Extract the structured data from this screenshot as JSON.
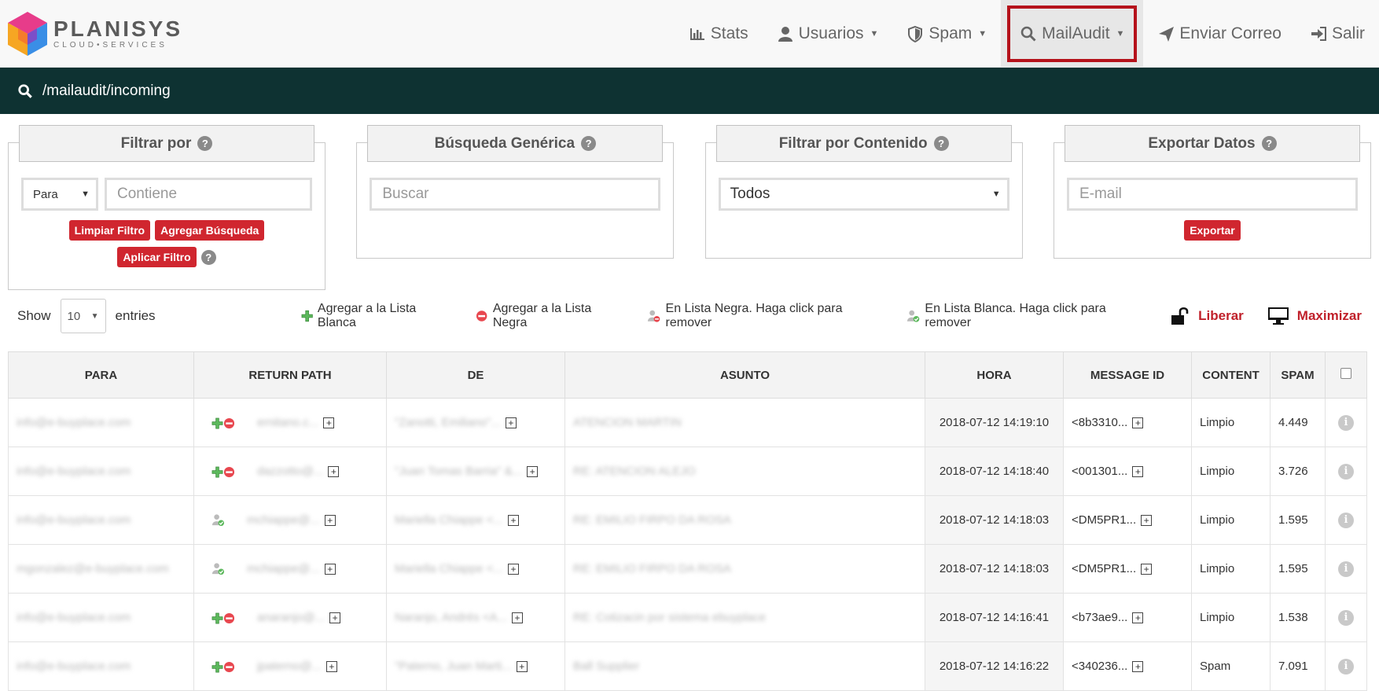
{
  "brand": {
    "name": "PLANISYS",
    "sub": "CLOUD•SERVICES"
  },
  "nav": {
    "stats": "Stats",
    "usuarios": "Usuarios",
    "spam": "Spam",
    "mailaudit": "MailAudit",
    "enviar": "Enviar Correo",
    "salir": "Salir"
  },
  "path": "/mailaudit/incoming",
  "panels": {
    "filtrar": {
      "title": "Filtrar por",
      "select_value": "Para",
      "input_placeholder": "Contiene",
      "btn_limpiar": "Limpiar Filtro",
      "btn_agregar": "Agregar Búsqueda",
      "btn_aplicar": "Aplicar Filtro"
    },
    "busqueda": {
      "title": "Búsqueda Genérica",
      "input_placeholder": "Buscar"
    },
    "contenido": {
      "title": "Filtrar por Contenido",
      "select_value": "Todos"
    },
    "exportar": {
      "title": "Exportar Datos",
      "input_placeholder": "E-mail",
      "btn_exportar": "Exportar"
    }
  },
  "toolbar": {
    "show_label": "Show",
    "entries_value": "10",
    "entries_label": "entries",
    "whitelist_add": "Agregar a la Lista Blanca",
    "blacklist_add": "Agregar a la Lista Negra",
    "in_blacklist": "En Lista Negra. Haga click para remover",
    "in_whitelist": "En Lista Blanca. Haga click para remover",
    "liberar": "Liberar",
    "maximizar": "Maximizar"
  },
  "table": {
    "headers": [
      "PARA",
      "RETURN PATH",
      "DE",
      "ASUNTO",
      "HORA",
      "MESSAGE ID",
      "CONTENT",
      "SPAM"
    ],
    "rows": [
      {
        "para": "info@e-buyplace.com",
        "return_path": "ernitano.c...",
        "de": "\"Zanotti, Emiliano\"...",
        "asunto": "ATENCION MARTIN",
        "hora": "2018-07-12 14:19:10",
        "message_id": "<8b3310...",
        "content": "Limpio",
        "spam": "4.449",
        "icons": "add"
      },
      {
        "para": "info@e-buyplace.com",
        "return_path": "dazzotto@...",
        "de": "\"Juan Tomas Barria\" &...",
        "asunto": "RE: ATENCION ALEJO",
        "hora": "2018-07-12 14:18:40",
        "message_id": "<001301...",
        "content": "Limpio",
        "spam": "3.726",
        "icons": "add"
      },
      {
        "para": "info@e-buyplace.com",
        "return_path": "mchiappe@...",
        "de": "Mariella Chiappe <...",
        "asunto": "RE: EMILIO FIRPO DA ROSA",
        "hora": "2018-07-12 14:18:03",
        "message_id": "<DM5PR1...",
        "content": "Limpio",
        "spam": "1.595",
        "icons": "white"
      },
      {
        "para": "mgonzalez@e-buyplace.com",
        "return_path": "mchiappe@...",
        "de": "Mariella Chiappe <...",
        "asunto": "RE: EMILIO FIRPO DA ROSA",
        "hora": "2018-07-12 14:18:03",
        "message_id": "<DM5PR1...",
        "content": "Limpio",
        "spam": "1.595",
        "icons": "white"
      },
      {
        "para": "info@e-buyplace.com",
        "return_path": "anaranjo@...",
        "de": "Naranjo, Andrés <A...",
        "asunto": "RE: Cotizacin por sistema ebuyplace",
        "hora": "2018-07-12 14:16:41",
        "message_id": "<b73ae9...",
        "content": "Limpio",
        "spam": "1.538",
        "icons": "add"
      },
      {
        "para": "info@e-buyplace.com",
        "return_path": "jpaterno@...",
        "de": "\"Paterno, Juan Marti...",
        "asunto": "Ball Supplier",
        "hora": "2018-07-12 14:16:22",
        "message_id": "<340236...",
        "content": "Spam",
        "spam": "7.091",
        "icons": "add"
      }
    ]
  },
  "colors": {
    "accent_red": "#d0262f",
    "path_bar": "#0e3232",
    "highlight_border": "#b5121b"
  }
}
